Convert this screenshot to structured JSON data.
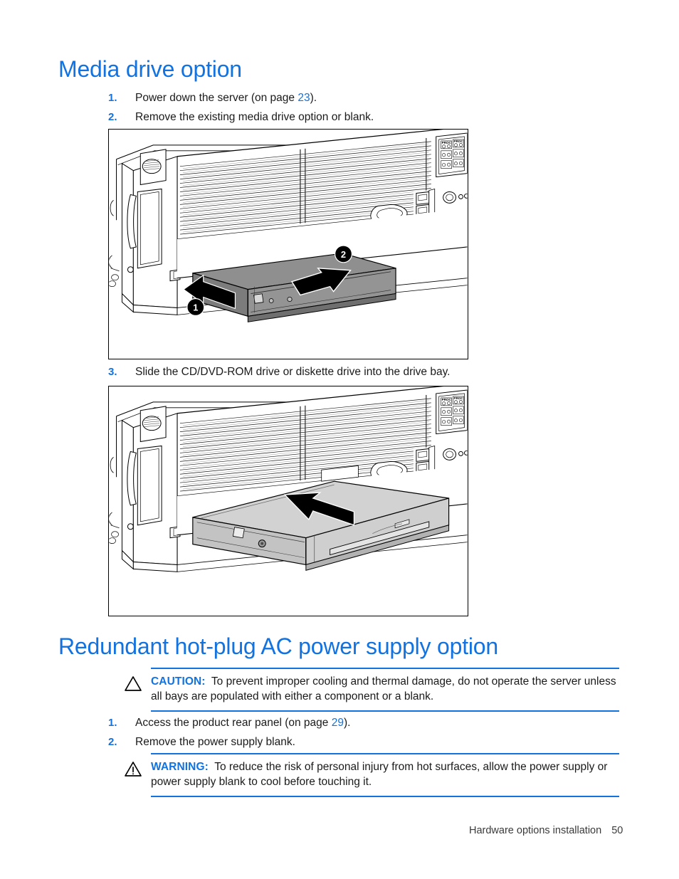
{
  "document": {
    "type": "hardware-installation-guide-page"
  },
  "sections": [
    {
      "heading": "Media drive option"
    },
    {
      "heading": "Redundant hot-plug AC power supply option"
    }
  ],
  "media_drive": {
    "heading": "Media drive option",
    "steps": [
      {
        "number": "1.",
        "text_before": "Power down the server (on page ",
        "page_ref": "23",
        "text_after": ")."
      },
      {
        "number": "2.",
        "text_before": "Remove the existing media drive option or blank.",
        "page_ref": "",
        "text_after": ""
      },
      {
        "number": "3.",
        "text_before": "Slide the CD/DVD-ROM drive or diskette drive into the drive bay.",
        "page_ref": "",
        "text_after": ""
      }
    ],
    "figure_1": {
      "caption": "Server front panel with media drive blank being removed",
      "callouts": [
        "1",
        "2"
      ],
      "drive_fill": "#8f8f8f"
    },
    "figure_2": {
      "caption": "Server front panel with CD/DVD-ROM drive being slid into the drive bay",
      "callouts": [],
      "drive_fill": "#d2d2d2"
    }
  },
  "power_supply": {
    "heading": "Redundant hot-plug AC power supply option",
    "caution": {
      "icon": "caution-triangle-icon",
      "label": "CAUTION:",
      "text": "To prevent improper cooling and thermal damage, do not operate the server unless all bays are populated with either a component or a blank."
    },
    "steps": [
      {
        "number": "1.",
        "text_before": "Access the product rear panel (on page ",
        "page_ref": "29",
        "text_after": ")."
      },
      {
        "number": "2.",
        "text_before": "Remove the power supply blank.",
        "page_ref": "",
        "text_after": ""
      }
    ],
    "warning": {
      "icon": "warning-triangle-exclamation-icon",
      "label": "WARNING:",
      "text": "To reduce the risk of personal injury from hot surfaces, allow the power supply or power supply blank to cool before touching it."
    }
  },
  "footer": {
    "chapter": "Hardware options installation",
    "page_number": "50"
  },
  "colors": {
    "accent_blue": "#1272e0",
    "body_text": "#1a1a1a",
    "rule_blue": "#1272e0"
  }
}
